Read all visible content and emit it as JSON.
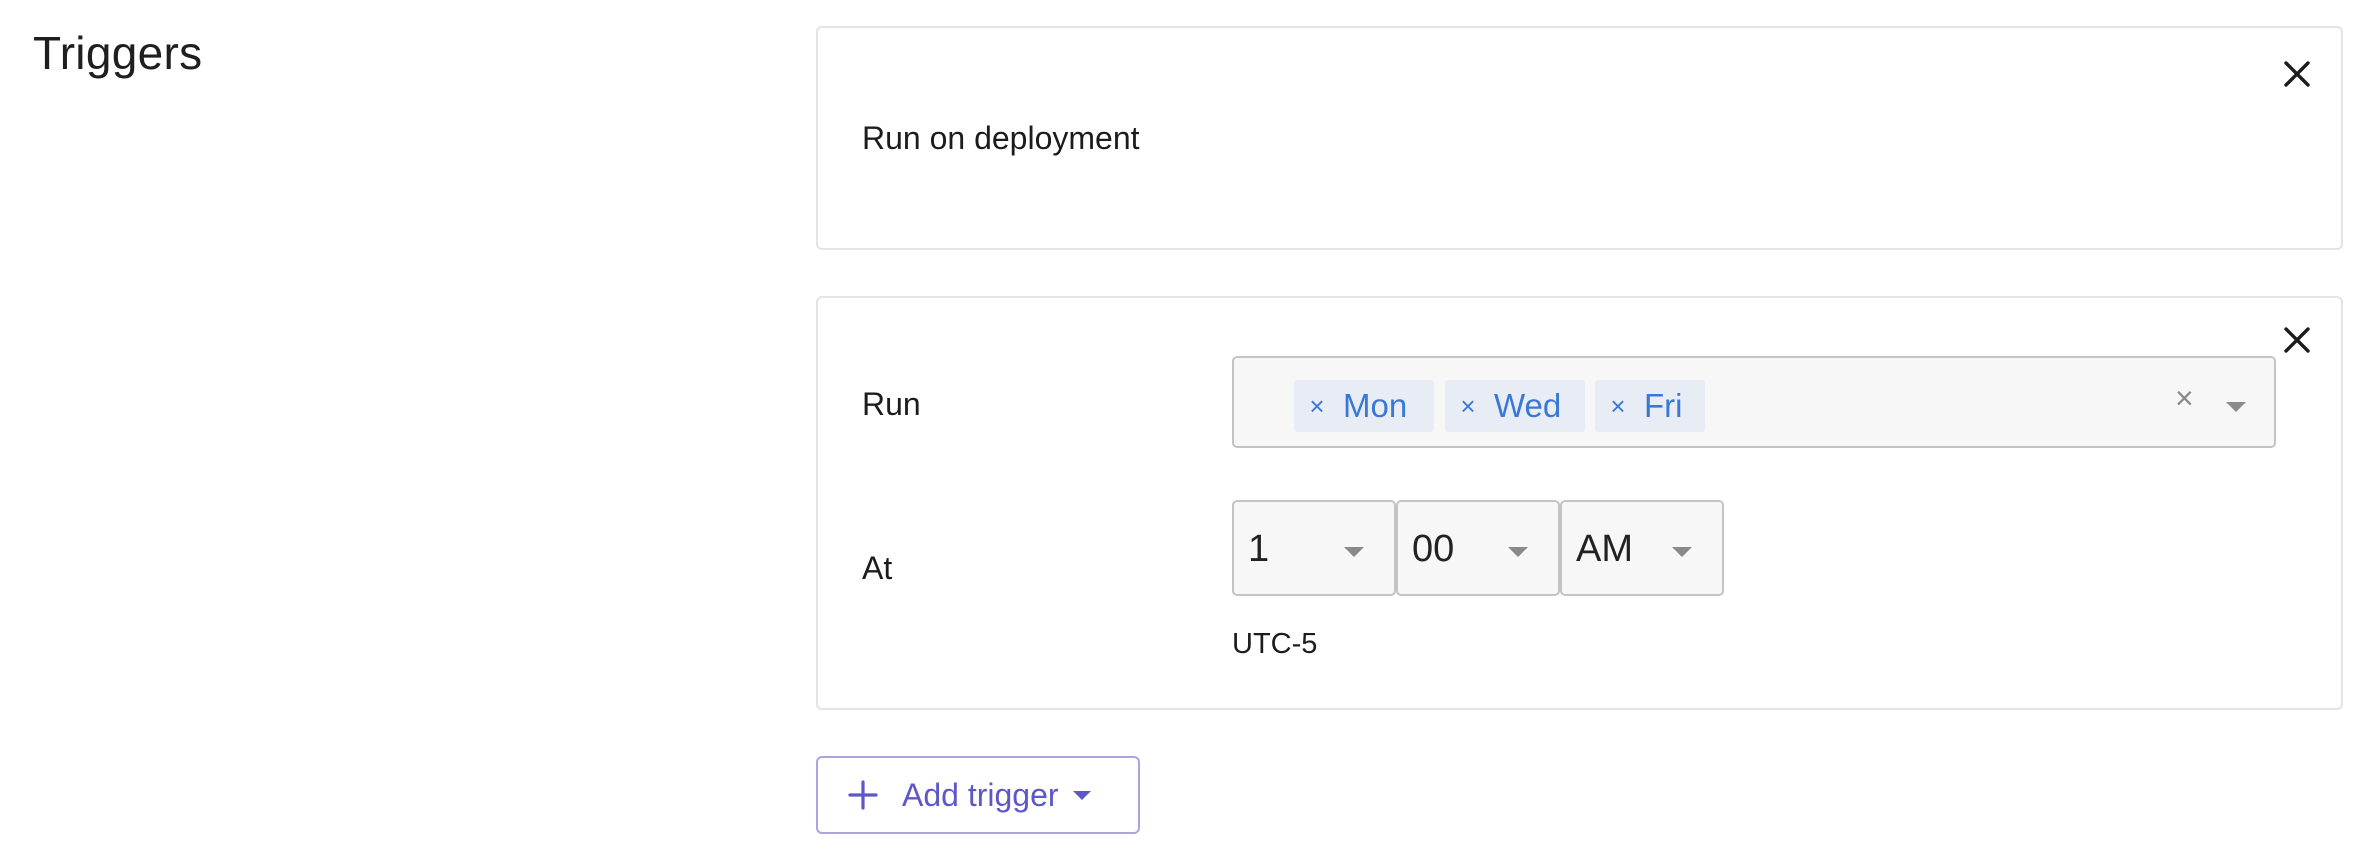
{
  "section": {
    "title": "Triggers"
  },
  "trigger_deployment": {
    "label": "Run on deployment"
  },
  "trigger_schedule": {
    "run_label": "Run",
    "days": [
      {
        "label": "Mon",
        "remove": "×"
      },
      {
        "label": "Wed",
        "remove": "×"
      },
      {
        "label": "Fri",
        "remove": "×"
      }
    ],
    "clear_glyph": "×",
    "at_label": "At",
    "hour": "1",
    "minute": "00",
    "ampm": "AM",
    "timezone": "UTC-5"
  },
  "actions": {
    "add_trigger_label": "Add trigger"
  },
  "colors": {
    "accent": "#5c58c8",
    "chip_text": "#3b78d6",
    "chip_bg": "#e8edf5",
    "card_border": "#e4e4e6"
  },
  "icons": {
    "card_close": "close-icon",
    "add": "plus-icon",
    "dropdown": "chevron-down-icon"
  }
}
